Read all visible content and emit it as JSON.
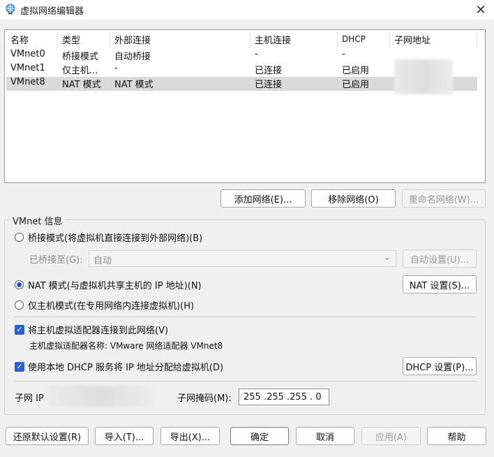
{
  "window": {
    "title": "虚拟网络编辑器",
    "close_icon": "close-icon"
  },
  "table": {
    "headers": [
      "名称",
      "类型",
      "外部连接",
      "主机连接",
      "DHCP",
      "子网地址"
    ],
    "rows": [
      {
        "name": "VMnet0",
        "type": "桥接模式",
        "external": "自动桥接",
        "host": "-",
        "dhcp": "-",
        "subnet": ""
      },
      {
        "name": "VMnet1",
        "type": "仅主机...",
        "external": "-",
        "host": "已连接",
        "dhcp": "已启用",
        "subnet": ""
      },
      {
        "name": "VMnet8",
        "type": "NAT 模式",
        "external": "NAT 模式",
        "host": "已连接",
        "dhcp": "已启用",
        "subnet": ""
      }
    ],
    "selected_row": "VMnet8"
  },
  "list_buttons": {
    "add": "添加网络(E)...",
    "remove": "移除网络(O)",
    "rename": "重命名网络(W)..."
  },
  "info": {
    "group_label": "VMnet 信息",
    "bridge_label": "桥接模式(将虚拟机直接连接到外部网络)(B)",
    "bridged_to_label": "已桥接至(G):",
    "bridged_to_value": "自动",
    "auto_settings": "自动设置(U)...",
    "nat_label": "NAT 模式(与虚拟机共享主机的 IP 地址)(N)",
    "nat_settings": "NAT 设置(S)...",
    "hostonly_label": "仅主机模式(在专用网络内连接虚拟机)(H)",
    "connect_adapter_label": "将主机虚拟适配器连接到此网络(V)",
    "adapter_name_label": "主机虚拟适配器名称: VMware 网络适配器 VMnet8",
    "dhcp_label": "使用本地 DHCP 服务将 IP 地址分配给虚拟机(D)",
    "dhcp_settings": "DHCP 设置(P)...",
    "subnet_ip_label": "子网 IP",
    "subnet_mask_label": "子网掩码(M):",
    "subnet_mask_value": "255 .255 .255 . 0"
  },
  "footer": {
    "restore": "还原默认设置(R)",
    "import": "导入(T)...",
    "export": "导出(X)...",
    "ok": "确定",
    "cancel": "取消",
    "apply": "应用(A)",
    "help": "帮助"
  }
}
